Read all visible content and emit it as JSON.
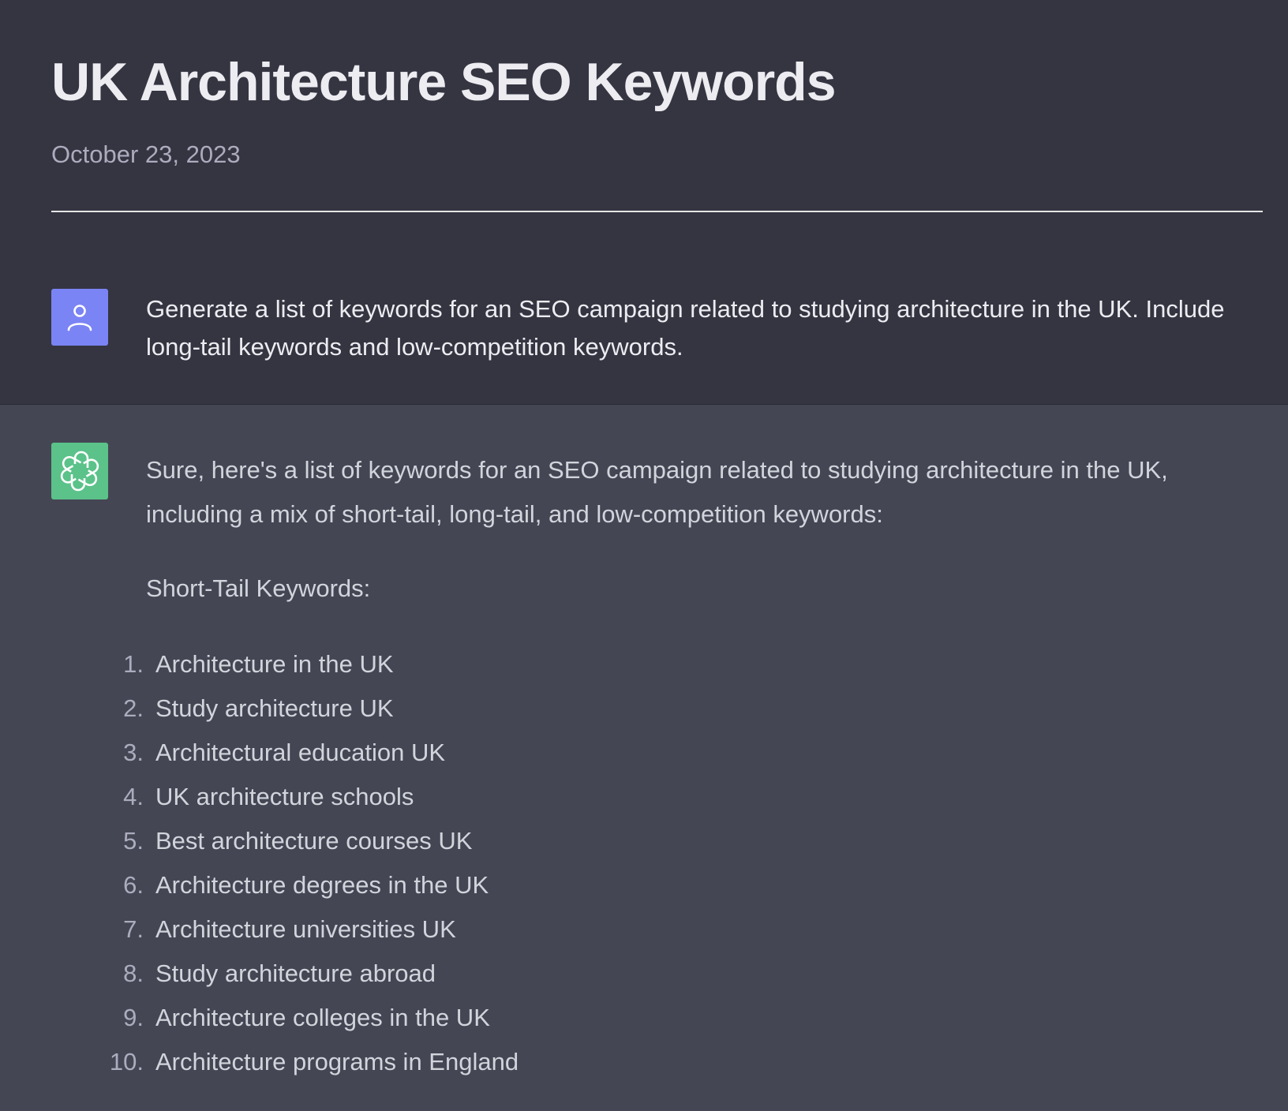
{
  "header": {
    "title": "UK Architecture SEO Keywords",
    "date": "October 23, 2023"
  },
  "conversation": {
    "user": {
      "avatar_icon": "user-icon",
      "avatar_color": "#7b84f4",
      "message": "Generate a list of keywords for an SEO campaign related to studying architecture in the UK. Include long-tail keywords and low-competition keywords."
    },
    "assistant": {
      "avatar_icon": "openai-logo-icon",
      "avatar_color": "#5bc28a",
      "intro": "Sure, here's a list of keywords for an SEO campaign related to studying architecture in the UK, including a mix of short-tail, long-tail, and low-competition keywords:",
      "section_heading": "Short-Tail Keywords:",
      "keywords": [
        {
          "num": "1.",
          "text": "Architecture in the UK"
        },
        {
          "num": "2.",
          "text": "Study architecture UK"
        },
        {
          "num": "3.",
          "text": "Architectural education UK"
        },
        {
          "num": "4.",
          "text": "UK architecture schools"
        },
        {
          "num": "5.",
          "text": "Best architecture courses UK"
        },
        {
          "num": "6.",
          "text": "Architecture degrees in the UK"
        },
        {
          "num": "7.",
          "text": "Architecture universities UK"
        },
        {
          "num": "8.",
          "text": "Study architecture abroad"
        },
        {
          "num": "9.",
          "text": "Architecture colleges in the UK"
        },
        {
          "num": "10.",
          "text": "Architecture programs in England"
        }
      ]
    }
  }
}
